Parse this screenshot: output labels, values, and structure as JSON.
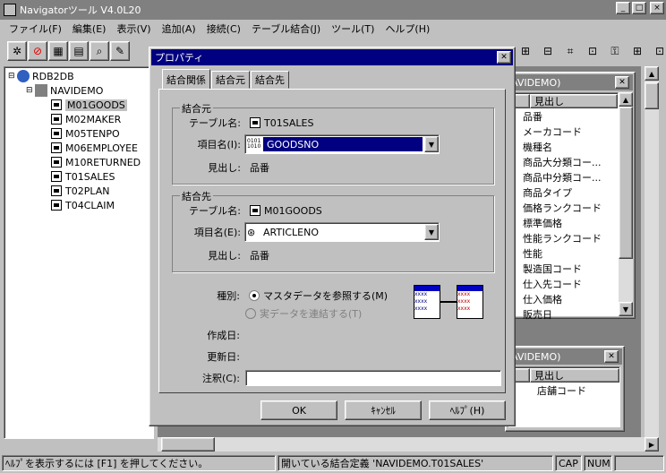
{
  "app": {
    "title": "Navigatorツール V4.0L20"
  },
  "window_buttons": [
    "_",
    "□",
    "×"
  ],
  "menu": [
    "ファイル(F)",
    "編集(E)",
    "表示(V)",
    "追加(A)",
    "接続(C)",
    "テーブル結合(J)",
    "ツール(T)",
    "ヘルプ(H)"
  ],
  "tree": {
    "root": "RDB2DB",
    "db": "NAVIDEMO",
    "tables": [
      "M01GOODS",
      "M02MAKER",
      "M05TENPO",
      "M06EMPLOYEE",
      "M10RETURNED",
      "T01SALES",
      "T02PLAN",
      "T04CLAIM"
    ],
    "selected": "M01GOODS"
  },
  "panel1": {
    "title": "AVIDEMO)",
    "col": "見出し",
    "items": [
      "品番",
      "メーカコード",
      "機種名",
      "商品大分類コー...",
      "商品中分類コー...",
      "商品タイプ",
      "価格ランクコード",
      "標準価格",
      "性能ランクコード",
      "性能",
      "製造国コード",
      "仕入先コード",
      "仕入価格",
      "販売日"
    ]
  },
  "panel2": {
    "title": "AVIDEMO)",
    "col": "見出し",
    "items": [
      "店舗コード"
    ]
  },
  "dialog": {
    "title": "プロパティ",
    "tabs": [
      "結合関係",
      "結合元",
      "結合先"
    ],
    "source": {
      "group": "結合元",
      "table_label": "テーブル名:",
      "table": "T01SALES",
      "item_label": "項目名(I):",
      "item": "GOODSNO",
      "caption_label": "見出し:",
      "caption": "品番"
    },
    "target": {
      "group": "結合先",
      "table_label": "テーブル名:",
      "table": "M01GOODS",
      "item_label": "項目名(E):",
      "item": "ARTICLENO",
      "caption_label": "見出し:",
      "caption": "品番"
    },
    "kind_label": "種別:",
    "radio1": "マスタデータを参照する(M)",
    "radio2": "実データを連結する(T)",
    "created_label": "作成日:",
    "updated_label": "更新日:",
    "note_label": "注釈(C):",
    "note_value": "",
    "ok": "OK",
    "cancel": "ｷｬﾝｾﾙ",
    "help": "ﾍﾙﾌﾟ(H)"
  },
  "status": {
    "hint": "ﾍﾙﾌﾟを表示するには [F1] を押してください。",
    "message": "開いている結合定義 'NAVIDEMO.T01SALES'",
    "cap": "CAP",
    "num": "NUM"
  }
}
